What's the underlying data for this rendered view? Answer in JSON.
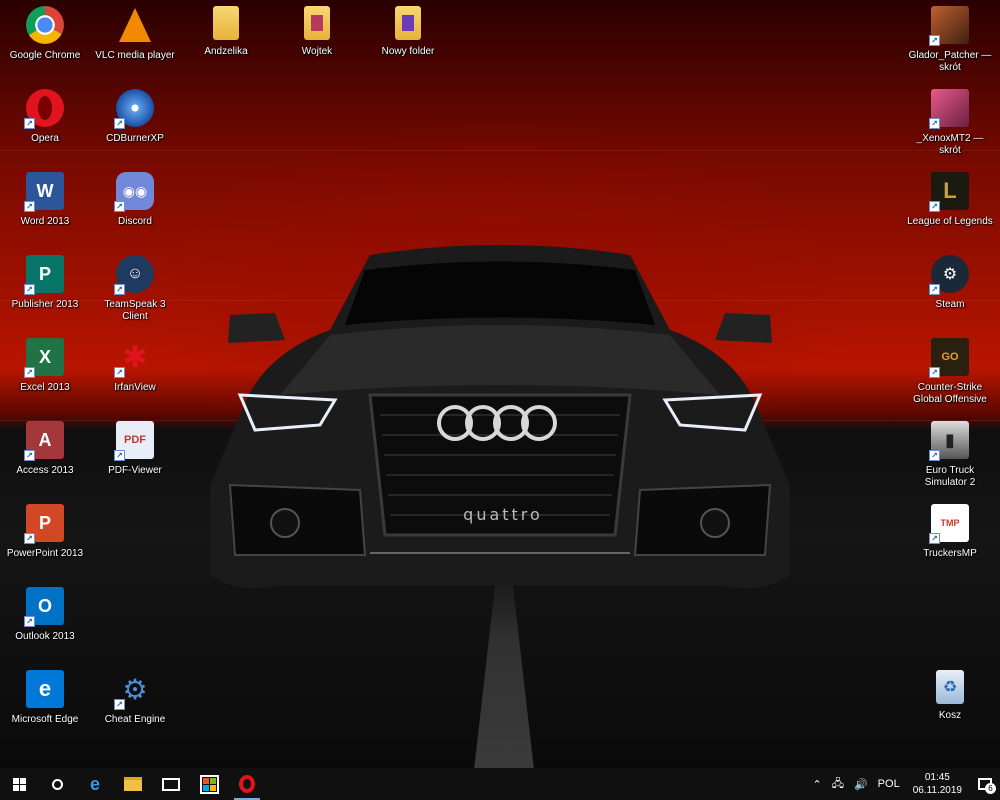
{
  "desktop": {
    "icons": [
      {
        "label": "Google Chrome",
        "icon": "chrome-icon"
      },
      {
        "label": "VLC media player",
        "icon": "vlc-icon"
      },
      {
        "label": "Andzelika",
        "icon": "folder-icon"
      },
      {
        "label": "Wojtek",
        "icon": "folder-icon"
      },
      {
        "label": "Nowy folder",
        "icon": "folder-icon"
      },
      {
        "label": "Glador_Patcher — skrót",
        "icon": "game-icon"
      },
      {
        "label": "Opera",
        "icon": "opera-icon"
      },
      {
        "label": "CDBurnerXP",
        "icon": "cd-icon"
      },
      {
        "label": "_XenoxMT2 — skrót",
        "icon": "game-icon"
      },
      {
        "label": "Word 2013",
        "icon": "word-icon"
      },
      {
        "label": "Discord",
        "icon": "discord-icon"
      },
      {
        "label": "League of Legends",
        "icon": "lol-icon"
      },
      {
        "label": "Publisher 2013",
        "icon": "publisher-icon"
      },
      {
        "label": "TeamSpeak 3 Client",
        "icon": "teamspeak-icon"
      },
      {
        "label": "Steam",
        "icon": "steam-icon"
      },
      {
        "label": "Excel 2013",
        "icon": "excel-icon"
      },
      {
        "label": "IrfanView",
        "icon": "irfanview-icon"
      },
      {
        "label": "Counter-Strike Global Offensive",
        "icon": "csgo-icon"
      },
      {
        "label": "Access 2013",
        "icon": "access-icon"
      },
      {
        "label": "PDF-Viewer",
        "icon": "pdf-icon"
      },
      {
        "label": "Euro Truck Simulator 2",
        "icon": "truck-icon"
      },
      {
        "label": "PowerPoint 2013",
        "icon": "powerpoint-icon"
      },
      {
        "label": "TruckersMP",
        "icon": "truckersmp-icon"
      },
      {
        "label": "Outlook 2013",
        "icon": "outlook-icon"
      },
      {
        "label": "Microsoft Edge",
        "icon": "edge-icon"
      },
      {
        "label": "Cheat Engine",
        "icon": "cheat-engine-icon"
      },
      {
        "label": "Kosz",
        "icon": "recycle-bin-icon"
      }
    ],
    "wallpaper_text": "quattro"
  },
  "taskbar": {
    "language": "POL",
    "time": "01:45",
    "date": "06.11.2019",
    "notification_count": "6"
  },
  "colors": {
    "taskbar": "#101010",
    "accent": "#79a8e8"
  }
}
